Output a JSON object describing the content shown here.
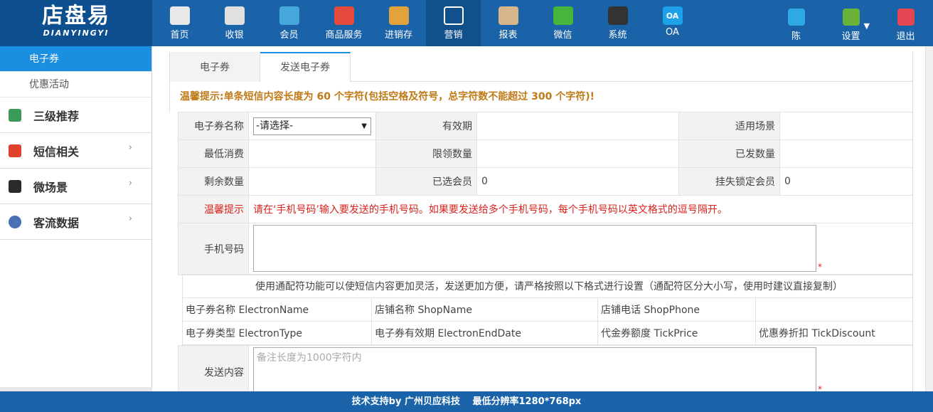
{
  "logo": {
    "title": "店盘易",
    "subtitle": "DIANYINGYI"
  },
  "nav": [
    {
      "label": "首页",
      "icon": "home-icon",
      "color": "#e8e8e8"
    },
    {
      "label": "收银",
      "icon": "cash-register-icon",
      "color": "#e0e0e0"
    },
    {
      "label": "会员",
      "icon": "member-icon",
      "color": "#46a7dc"
    },
    {
      "label": "商品服务",
      "icon": "goods-icon",
      "color": "#e64a3d"
    },
    {
      "label": "进销存",
      "icon": "inventory-icon",
      "color": "#e3a33b"
    },
    {
      "label": "营销",
      "icon": "megaphone-icon",
      "color": "#ffffff"
    },
    {
      "label": "报表",
      "icon": "report-icon",
      "color": "#d9b68a"
    },
    {
      "label": "微信",
      "icon": "wechat-icon",
      "color": "#46b53b"
    },
    {
      "label": "系统",
      "icon": "monitor-icon",
      "color": "#333333"
    },
    {
      "label": "OA",
      "icon": "oa-icon",
      "color": "#1da1e8",
      "icon_text": "OA"
    }
  ],
  "right_nav": [
    {
      "label": "陈",
      "icon": "user-icon",
      "color": "#2fa8e6"
    },
    {
      "label": "设置",
      "icon": "gear-icon",
      "color": "#6ab33a"
    },
    {
      "label": "退出",
      "icon": "logout-icon",
      "color": "#e24652"
    }
  ],
  "sidebar": {
    "sub_items": [
      {
        "label": "电子券",
        "active": true
      },
      {
        "label": "优惠活动",
        "active": false
      }
    ],
    "main_items": [
      {
        "label": "三级推荐",
        "icon": "layers-icon",
        "chevron": false
      },
      {
        "label": "短信相关",
        "icon": "phone-icon",
        "chevron": true
      },
      {
        "label": "微场景",
        "icon": "mobile-icon",
        "chevron": true
      },
      {
        "label": "客流数据",
        "icon": "chart-circle-icon",
        "chevron": true
      }
    ]
  },
  "tabs": [
    {
      "label": "电子券",
      "active": false
    },
    {
      "label": "发送电子券",
      "active": true
    }
  ],
  "warning": "温馨提示:单条短信内容长度为 60 个字符(包括空格及符号，总字符数不能超过 300 个字符)!",
  "form": {
    "coupon_name_label": "电子券名称",
    "coupon_select_value": "-请选择-",
    "validity_label": "有效期",
    "validity_value": "",
    "scene_label": "适用场景",
    "scene_value": "",
    "min_spend_label": "最低消费",
    "min_spend_value": "",
    "limit_label": "限领数量",
    "limit_value": "",
    "issued_label": "已发数量",
    "issued_value": "",
    "remaining_label": "剩余数量",
    "remaining_value": "",
    "selected_label": "已选会员",
    "selected_value": "0",
    "locked_label": "挂失锁定会员",
    "locked_value": "0",
    "tip_label": "温馨提示",
    "tip_text": "请在‘手机号码’输入要发送的手机号码。如果要发送给多个手机号码，每个手机号码以英文格式的逗号隔开。",
    "phone_label": "手机号码",
    "phone_value": "",
    "content_label": "发送内容",
    "content_placeholder": "备注长度为1000字符内",
    "required_mark": "*"
  },
  "wildcards": {
    "header": "使用通配符功能可以使短信内容更加灵活，发送更加方便，请严格按照以下格式进行设置（通配符区分大小写，使用时建议直接复制）",
    "rows": [
      [
        "电子券名称 ElectronName",
        "店铺名称 ShopName",
        "店铺电话 ShopPhone",
        ""
      ],
      [
        "电子券类型 ElectronType",
        "电子券有效期 ElectronEndDate",
        "代金券额度 TickPrice",
        "优惠券折扣 TickDiscount"
      ]
    ]
  },
  "footer": "技术支持by 广州贝应科技　 最低分辨率1280*768px"
}
